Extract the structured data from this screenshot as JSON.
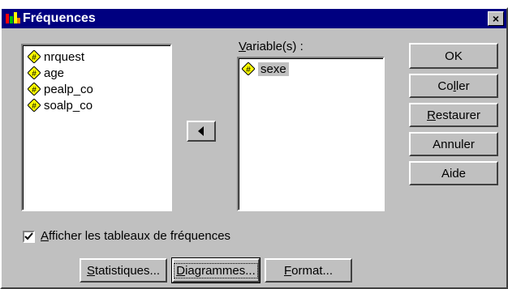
{
  "window": {
    "title": "Fréquences",
    "close_glyph": "×"
  },
  "source_list": {
    "items": [
      {
        "label": "nrquest",
        "icon": "numeric-variable-icon"
      },
      {
        "label": "age",
        "icon": "numeric-variable-icon"
      },
      {
        "label": "pealp_co",
        "icon": "numeric-variable-icon"
      },
      {
        "label": "soalp_co",
        "icon": "numeric-variable-icon"
      }
    ]
  },
  "variables_panel": {
    "label_mnemonic": "V",
    "label_rest": "ariable(s) :",
    "items": [
      {
        "label": "sexe",
        "icon": "numeric-variable-icon",
        "selected": true
      }
    ]
  },
  "move_button": {
    "icon": "arrow-left-icon"
  },
  "buttons": {
    "ok": "OK",
    "paste_pre": "Co",
    "paste_mn": "l",
    "paste_post": "ler",
    "reset_mn": "R",
    "reset_post": "estaurer",
    "cancel": "Annuler",
    "help": "Aide"
  },
  "checkbox": {
    "checked": true,
    "label_mnemonic": "A",
    "label_rest": "fficher les tableaux de fréquences"
  },
  "bottom_buttons": {
    "stats_mn": "S",
    "stats_rest": "tatistiques...",
    "charts_mn": "D",
    "charts_rest": "iagrammes...",
    "format_mn": "F",
    "format_rest": "ormat..."
  },
  "colors": {
    "titlebar": "#000080",
    "face": "#c0c0c0",
    "icon_fill": "#ffff00"
  }
}
